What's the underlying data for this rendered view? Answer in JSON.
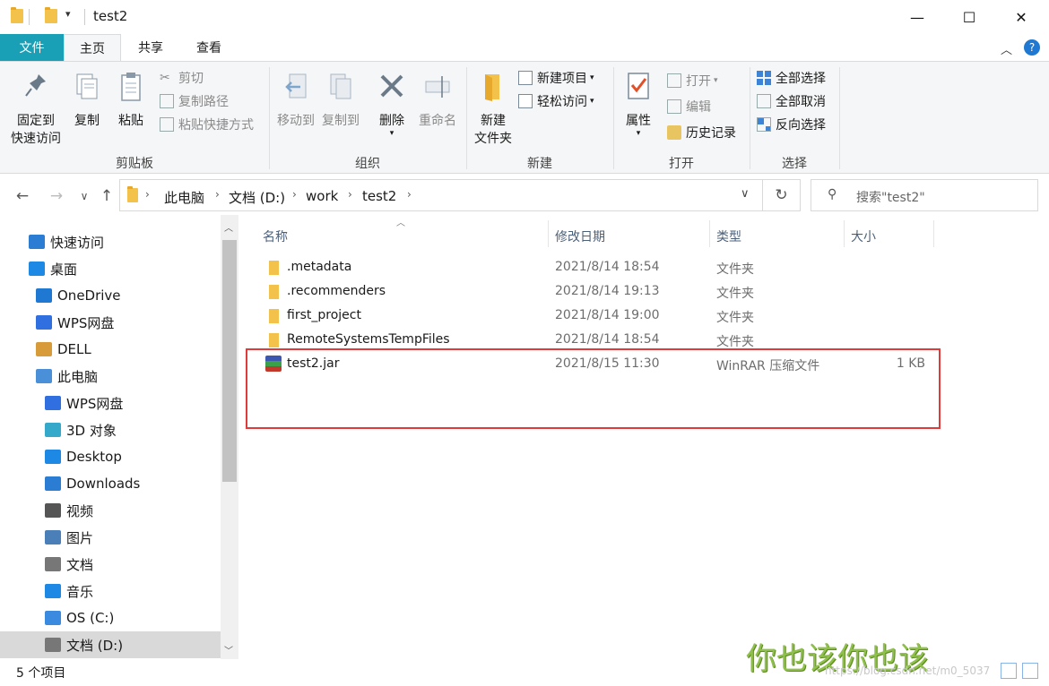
{
  "window": {
    "title": "test2",
    "minimize": "—",
    "maximize": "☐",
    "close": "✕"
  },
  "ribbon_tabs": {
    "file": "文件",
    "home": "主页",
    "share": "共享",
    "view": "查看"
  },
  "ribbon": {
    "clipboard": {
      "label": "剪贴板",
      "pin_line1": "固定到",
      "pin_line2": "快速访问",
      "copy": "复制",
      "paste": "粘贴",
      "cut": "剪切",
      "copy_path": "复制路径",
      "paste_shortcut": "粘贴快捷方式"
    },
    "organize": {
      "label": "组织",
      "move_to": "移动到",
      "copy_to": "复制到",
      "delete": "删除",
      "rename": "重命名"
    },
    "new": {
      "label": "新建",
      "new_folder_line1": "新建",
      "new_folder_line2": "文件夹",
      "new_item": "新建项目",
      "easy_access": "轻松访问"
    },
    "open": {
      "label": "打开",
      "properties": "属性",
      "open": "打开",
      "edit": "编辑",
      "history": "历史记录"
    },
    "select": {
      "label": "选择",
      "select_all": "全部选择",
      "select_none": "全部取消",
      "invert": "反向选择"
    }
  },
  "address": {
    "crumbs": [
      "此电脑",
      "文档 (D:)",
      "work",
      "test2"
    ],
    "search_placeholder": "搜索\"test2\""
  },
  "nav_pane": [
    {
      "label": "快速访问",
      "icon": "star-icon",
      "color": "#2b7cd3"
    },
    {
      "label": "桌面",
      "icon": "desktop-icon",
      "color": "#1e88e5"
    },
    {
      "label": "OneDrive",
      "icon": "cloud-icon",
      "color": "#1f78d1"
    },
    {
      "label": "WPS网盘",
      "icon": "cloud-icon",
      "color": "#2f6fe0"
    },
    {
      "label": "DELL",
      "icon": "user-icon",
      "color": "#d89b3a"
    },
    {
      "label": "此电脑",
      "icon": "computer-icon",
      "color": "#4a90d9"
    },
    {
      "label": "WPS网盘",
      "icon": "cloud-icon",
      "color": "#2f6fe0"
    },
    {
      "label": "3D 对象",
      "icon": "cube-icon",
      "color": "#34a9c9"
    },
    {
      "label": "Desktop",
      "icon": "desktop-icon",
      "color": "#1e88e5"
    },
    {
      "label": "Downloads",
      "icon": "download-icon",
      "color": "#2b7cd3"
    },
    {
      "label": "视频",
      "icon": "film-icon",
      "color": "#555555"
    },
    {
      "label": "图片",
      "icon": "picture-icon",
      "color": "#4a7fb8"
    },
    {
      "label": "文档",
      "icon": "document-icon",
      "color": "#777777"
    },
    {
      "label": "音乐",
      "icon": "music-icon",
      "color": "#1e88e5"
    },
    {
      "label": "OS (C:)",
      "icon": "drive-icon",
      "color": "#3a8be0"
    },
    {
      "label": "文档 (D:)",
      "icon": "drive-icon",
      "color": "#777777"
    }
  ],
  "columns": {
    "name": "名称",
    "date": "修改日期",
    "type": "类型",
    "size": "大小"
  },
  "files": [
    {
      "name": ".metadata",
      "date": "2021/8/14 18:54",
      "type": "文件夹",
      "size": "",
      "icon": "folder-icon"
    },
    {
      "name": ".recommenders",
      "date": "2021/8/14 19:13",
      "type": "文件夹",
      "size": "",
      "icon": "folder-icon"
    },
    {
      "name": "first_project",
      "date": "2021/8/14 19:00",
      "type": "文件夹",
      "size": "",
      "icon": "folder-icon"
    },
    {
      "name": "RemoteSystemsTempFiles",
      "date": "2021/8/14 18:54",
      "type": "文件夹",
      "size": "",
      "icon": "folder-icon"
    },
    {
      "name": "test2.jar",
      "date": "2021/8/15 11:30",
      "type": "WinRAR 压缩文件",
      "size": "1 KB",
      "icon": "winrar-icon"
    }
  ],
  "status": {
    "count": "5 个项目"
  },
  "watermark": {
    "text": "你也该你也该",
    "url": "https://blog.csdn.net/m0_5037"
  },
  "colors": {
    "accent": "#19a0b7",
    "highlight": "#e03b3b",
    "folder": "#f3c24a"
  }
}
